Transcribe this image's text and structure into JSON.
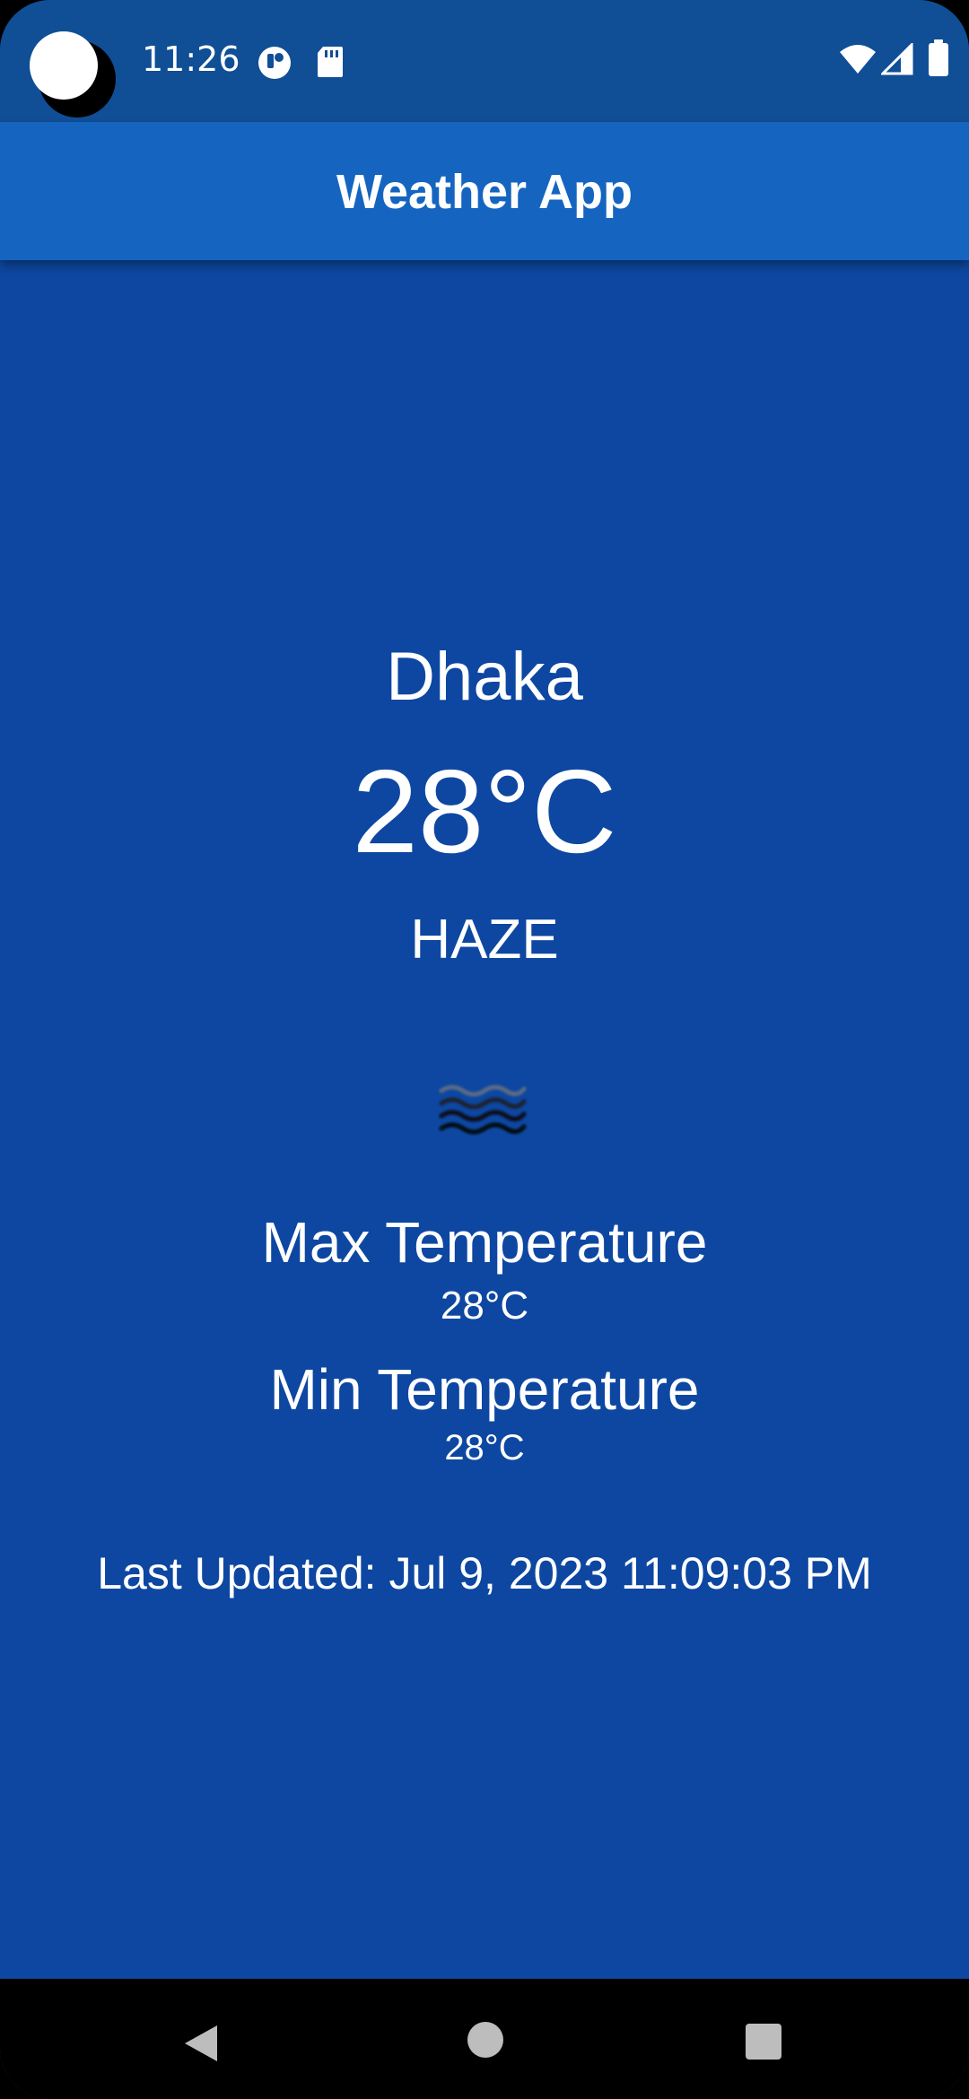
{
  "status_bar": {
    "time": "11:26",
    "icons": [
      "camera-cutout",
      "data-saver-icon",
      "sd-card-icon",
      "wifi-icon",
      "cellular-signal-icon",
      "battery-icon"
    ]
  },
  "app_bar": {
    "title": "Weather App",
    "color": "#1565c0"
  },
  "weather": {
    "city": "Dhaka",
    "temperature": "28°C",
    "condition": "HAZE",
    "condition_icon": "haze-icon",
    "max_label": "Max Temperature",
    "max_value": "28°C",
    "min_label": "Min Temperature",
    "min_value": "28°C",
    "last_updated": "Last Updated: Jul 9, 2023 11:09:03 PM",
    "background_color": "#0d47a1"
  },
  "nav_bar": {
    "buttons": [
      "back-icon",
      "home-icon",
      "recents-icon"
    ]
  }
}
